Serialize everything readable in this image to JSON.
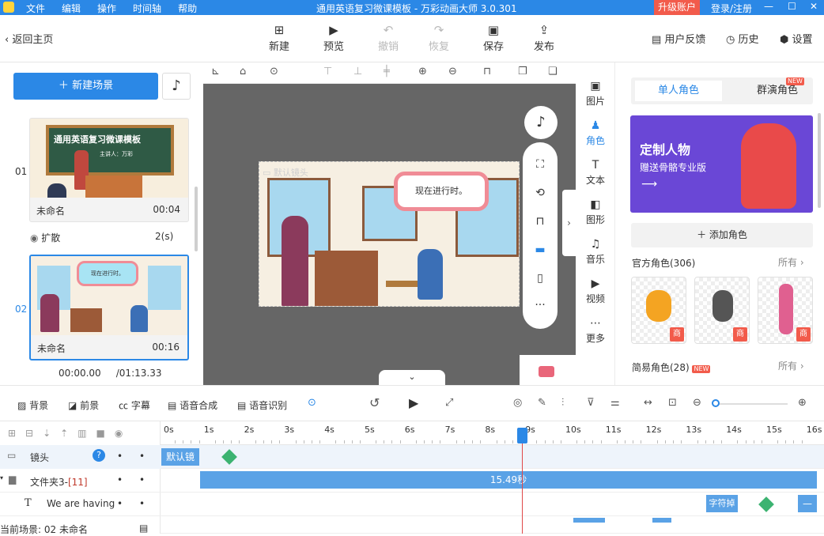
{
  "titlebar": {
    "menu": [
      "文件",
      "编辑",
      "操作",
      "时间轴",
      "帮助"
    ],
    "title": "通用英语复习微课模板 - 万彩动画大师 3.0.301",
    "upgrade": "升级账户",
    "login": "登录/注册"
  },
  "toolbar": {
    "back": "返回主页",
    "buttons": [
      {
        "label": "新建",
        "icon": "plus-square-icon",
        "enabled": true
      },
      {
        "label": "预览",
        "icon": "play-icon",
        "enabled": true
      },
      {
        "label": "撤销",
        "icon": "undo-icon",
        "enabled": false
      },
      {
        "label": "恢复",
        "icon": "redo-icon",
        "enabled": false
      },
      {
        "label": "保存",
        "icon": "save-icon",
        "enabled": true
      },
      {
        "label": "发布",
        "icon": "publish-icon",
        "enabled": true
      }
    ],
    "right": [
      "用户反馈",
      "历史",
      "设置"
    ]
  },
  "scenes": {
    "new_scene": "新建场景",
    "items": [
      {
        "num": "01",
        "thumb_title": "通用英语复习微课模板",
        "thumb_sub": "主讲人：万彩",
        "name": "未命名",
        "duration": "00:04"
      },
      {
        "num": "02",
        "thumb_bubble": "现在进行时。",
        "name": "未命名",
        "duration": "00:16"
      }
    ],
    "transition": {
      "label": "扩散",
      "duration": "2(s)"
    },
    "time_current": "00:00.00",
    "time_total": "/01:13.33"
  },
  "canvas": {
    "stage_label": "默认镜头",
    "bubble_text": "现在进行时。"
  },
  "sidetabs": [
    {
      "label": "图片",
      "icon": "image-icon"
    },
    {
      "label": "角色",
      "icon": "person-icon",
      "active": true
    },
    {
      "label": "文本",
      "icon": "text-icon"
    },
    {
      "label": "图形",
      "icon": "shape-icon"
    },
    {
      "label": "音乐",
      "icon": "music-icon"
    },
    {
      "label": "视频",
      "icon": "video-icon"
    },
    {
      "label": "更多",
      "icon": "more-icon"
    }
  ],
  "rpanel": {
    "tab_single": "单人角色",
    "tab_group": "群演角色",
    "new_badge": "NEW",
    "banner_title": "定制人物",
    "banner_sub": "赠送骨骼专业版",
    "add_char": "添加角色",
    "official_label": "官方角色(306)",
    "all_label": "所有",
    "simple_label": "简易角色(28)",
    "shop_badge": "商"
  },
  "timeline_tools": {
    "left": [
      "背景",
      "前景",
      "字幕",
      "语音合成",
      "语音识别"
    ]
  },
  "ruler": [
    "0s",
    "1s",
    "2s",
    "3s",
    "4s",
    "5s",
    "6s",
    "7s",
    "8s",
    "9s",
    "10s",
    "11s",
    "12s",
    "13s",
    "14s",
    "15s",
    "16s"
  ],
  "tracks": {
    "camera": {
      "label": "镜头",
      "clip": "默认镜"
    },
    "folder": {
      "label": "文件夹3-",
      "count": "[11]",
      "clip": "15.49秒"
    },
    "text": {
      "label": "We are having",
      "clip": "字符掉"
    }
  },
  "status": "当前场景: 02   未命名"
}
